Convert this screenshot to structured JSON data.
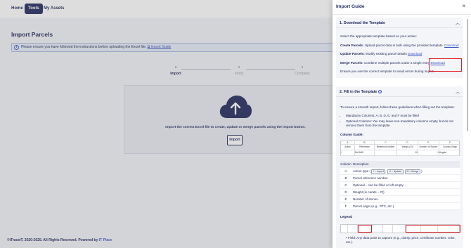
{
  "nav": {
    "home": "Home",
    "tools": "Tools",
    "assets": "My Assets"
  },
  "page": {
    "title": "Import Parcels",
    "info_prefix": "Please ensure you have followed the instructions before uploading the Excel file.",
    "info_link": "Import Guide",
    "steps": [
      {
        "num": "1",
        "label": "Import"
      },
      {
        "num": "2",
        "label": "Verify"
      },
      {
        "num": "3",
        "label": "Complete"
      }
    ],
    "drop_text": "Import the correct Excel file to create, update or merge parcels using the import button.",
    "import_button": "Import",
    "footer_text": "©iTraceiT, 2020-2025. All Rights Reserved. Powered by",
    "footer_brand": "IT Place"
  },
  "drawer": {
    "title": "Import Guide",
    "close": "×",
    "section1": {
      "title": "1. Download the Template",
      "intro": "Select the appropriate template based on your action:",
      "create_label": "Create Parcels:",
      "create_text": "Upload parcel data in bulk using the provided template.",
      "update_label": "Update Parcels:",
      "update_text": "Modify existing parcel details",
      "merge_label": "Merge Parcels:",
      "merge_text": "Combine multiple parcels under a single entry",
      "download": "Download",
      "note": "Ensure you use the correct template to avoid errors during import."
    },
    "section2": {
      "title": "2. Fill in the Template",
      "intro": "To ensure a smooth import, follow these guidelines when filling out the template:",
      "bullets": [
        "Mandatory Columns: A, B, D, E, and F must be filled",
        "Optional Columns: You may leave non-mandatory columns empty, but do not remove them from the template"
      ],
      "column_guide": "Column Guide:",
      "sheet_letters": [
        "A",
        "B",
        "C",
        "D",
        "E",
        "F"
      ],
      "sheet_headers": [
        "Action",
        "Reference",
        "Reference Mother",
        "Weight (Ct)",
        "Number of Stones",
        "Country Origin"
      ],
      "sheet_row": [
        "I",
        "Ref ABC",
        "",
        "10",
        "1",
        "Angola"
      ],
      "table_head": {
        "col": "Column",
        "desc": "Description"
      },
      "rows": [
        {
          "col": "A",
          "desc": "Action type (",
          "tags": [
            "I = Import",
            "U = Update",
            "M = Merge"
          ],
          "after": ")"
        },
        {
          "col": "B",
          "desc": "Parcel reference number."
        },
        {
          "col": "C",
          "desc": "Optional – can be filled or left empty."
        },
        {
          "col": "D",
          "desc": "Weight (in carats – Ct)"
        },
        {
          "col": "E",
          "desc": "Number of stones."
        },
        {
          "col": "F",
          "desc": "Parcel origin (e.g., DTC, etc.)."
        }
      ],
      "legend_title": "Legend",
      "legend_bullet": "Field: Any data point to capture (e.g., clarity, price, certificate number, color, etc.)."
    }
  }
}
